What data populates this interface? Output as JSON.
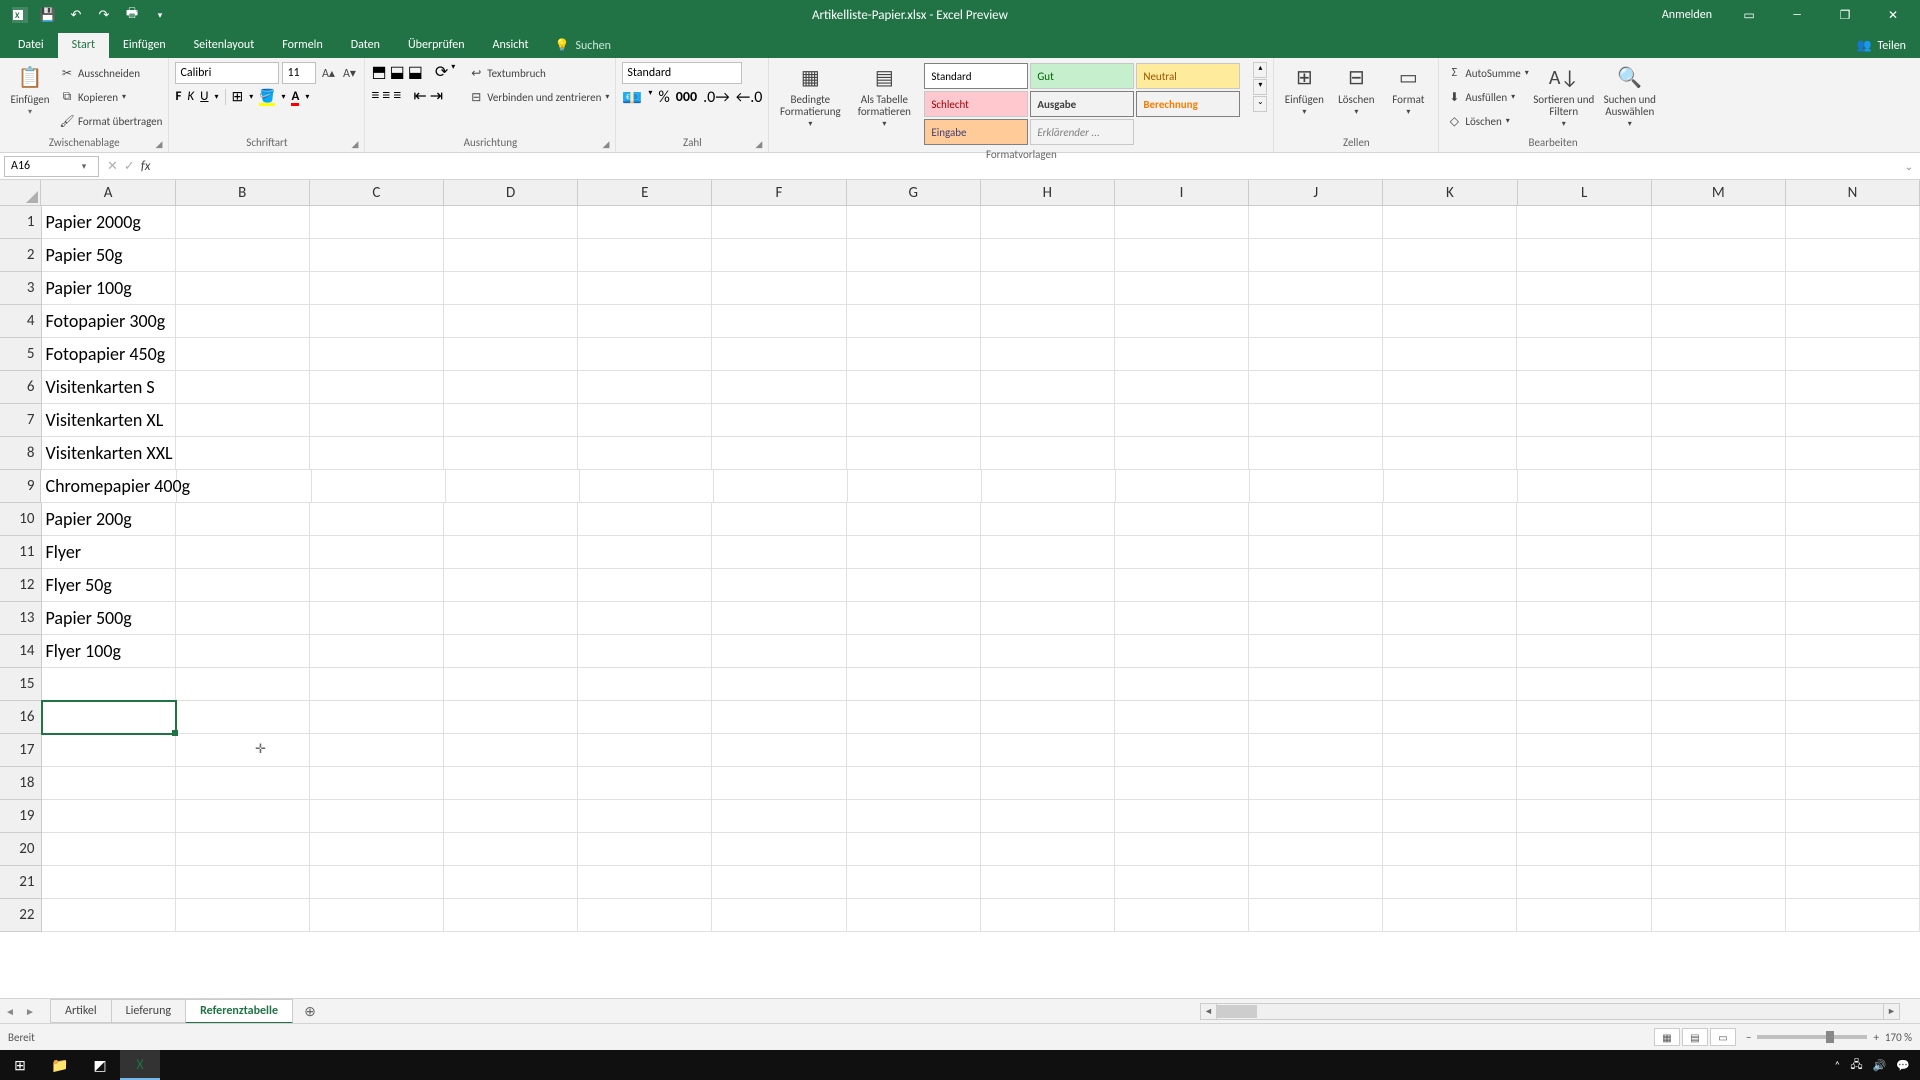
{
  "window": {
    "title": "Artikelliste-Papier.xlsx - Excel Preview",
    "signin": "Anmelden"
  },
  "tabs": {
    "file": "Datei",
    "home": "Start",
    "insert": "Einfügen",
    "pagelayout": "Seitenlayout",
    "formulas": "Formeln",
    "data": "Daten",
    "review": "Überprüfen",
    "view": "Ansicht",
    "tellme": "Suchen",
    "share": "Teilen"
  },
  "ribbon": {
    "clipboard": {
      "label": "Zwischenablage",
      "paste": "Einfügen",
      "cut": "Ausschneiden",
      "copy": "Kopieren",
      "painter": "Format übertragen"
    },
    "font": {
      "label": "Schriftart",
      "name": "Calibri",
      "size": "11"
    },
    "align": {
      "label": "Ausrichtung",
      "wrap": "Textumbruch",
      "merge": "Verbinden und zentrieren"
    },
    "number": {
      "label": "Zahl",
      "format": "Standard"
    },
    "styles": {
      "label": "Formatvorlagen",
      "cond": "Bedingte Formatierung",
      "table": "Als Tabelle formatieren",
      "row1": [
        "Standard",
        "Gut",
        "Neutral",
        "Schlecht"
      ],
      "row2": [
        "Ausgabe",
        "Berechnung",
        "Eingabe",
        "Erklärender ..."
      ]
    },
    "cells": {
      "label": "Zellen",
      "insert": "Einfügen",
      "delete": "Löschen",
      "format": "Format"
    },
    "editing": {
      "label": "Bearbeiten",
      "autosum": "AutoSumme",
      "fill": "Ausfüllen",
      "clear": "Löschen",
      "sort": "Sortieren und Filtern",
      "find": "Suchen und Auswählen"
    }
  },
  "namebox": "A16",
  "columns": [
    "A",
    "B",
    "C",
    "D",
    "E",
    "F",
    "G",
    "H",
    "I",
    "J",
    "K",
    "L",
    "M",
    "N"
  ],
  "colA_width": 136,
  "std_width": 136,
  "rows": [
    {
      "n": 1,
      "a": "Papier 2000g"
    },
    {
      "n": 2,
      "a": "Papier 50g"
    },
    {
      "n": 3,
      "a": "Papier 100g"
    },
    {
      "n": 4,
      "a": "Fotopapier 300g"
    },
    {
      "n": 5,
      "a": "Fotopapier 450g"
    },
    {
      "n": 6,
      "a": "Visitenkarten S"
    },
    {
      "n": 7,
      "a": "Visitenkarten XL"
    },
    {
      "n": 8,
      "a": "Visitenkarten XXL"
    },
    {
      "n": 9,
      "a": "Chromepapier 400g"
    },
    {
      "n": 10,
      "a": "Papier 200g"
    },
    {
      "n": 11,
      "a": "Flyer"
    },
    {
      "n": 12,
      "a": "Flyer 50g"
    },
    {
      "n": 13,
      "a": "Papier 500g"
    },
    {
      "n": 14,
      "a": "Flyer 100g"
    },
    {
      "n": 15,
      "a": ""
    },
    {
      "n": 16,
      "a": ""
    },
    {
      "n": 17,
      "a": ""
    },
    {
      "n": 18,
      "a": ""
    },
    {
      "n": 19,
      "a": ""
    },
    {
      "n": 20,
      "a": ""
    },
    {
      "n": 21,
      "a": ""
    },
    {
      "n": 22,
      "a": ""
    }
  ],
  "selected_row": 16,
  "sheetTabs": {
    "t1": "Artikel",
    "t2": "Lieferung",
    "t3": "Referenztabelle"
  },
  "status": {
    "ready": "Bereit",
    "zoom": "170 %"
  }
}
